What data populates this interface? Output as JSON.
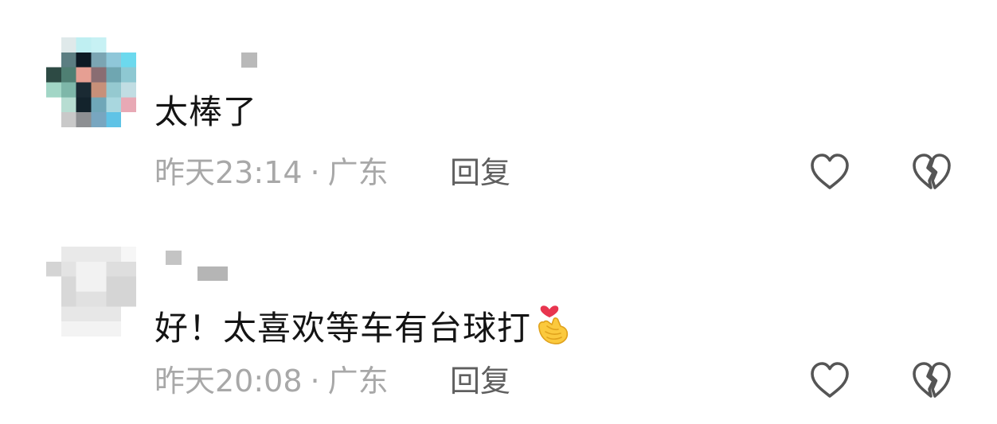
{
  "comments": [
    {
      "text": "太棒了",
      "time": "昨天23:14",
      "separator": "·",
      "location": "广东",
      "reply_label": "回复"
    },
    {
      "text": "好！太喜欢等车有台球打",
      "emoji": "finger-heart-emoji",
      "time": "昨天20:08",
      "separator": "·",
      "location": "广东",
      "reply_label": "回复"
    }
  ],
  "colors": {
    "text_primary": "#141414",
    "text_meta": "#a8a8a8",
    "reply": "#5f5f5f",
    "icon_stroke": "#555555"
  },
  "icons": [
    "heart-outline-icon",
    "broken-heart-icon"
  ]
}
